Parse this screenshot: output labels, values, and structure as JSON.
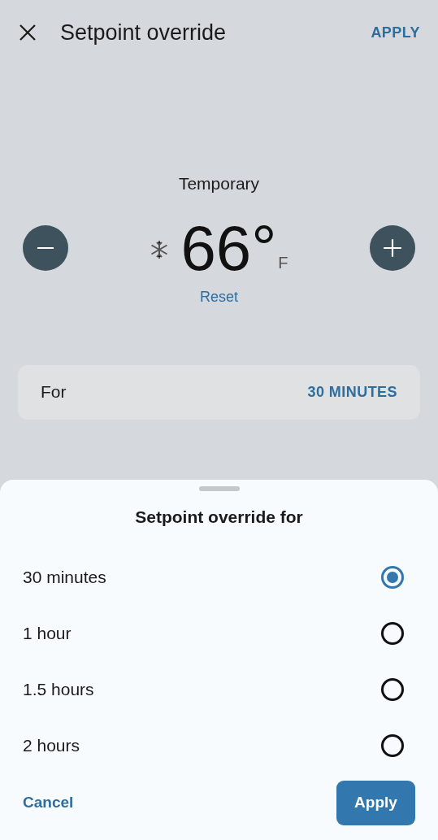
{
  "header": {
    "title": "Setpoint override",
    "action": "APPLY"
  },
  "setpoint": {
    "mode": "Temporary",
    "value": "66°",
    "unit": "F",
    "reset": "Reset"
  },
  "duration": {
    "label": "For",
    "value": "30 MINUTES"
  },
  "sheet": {
    "title": "Setpoint override for",
    "options": [
      {
        "label": "30 minutes",
        "selected": true
      },
      {
        "label": "1 hour",
        "selected": false
      },
      {
        "label": "1.5 hours",
        "selected": false
      },
      {
        "label": "2 hours",
        "selected": false
      }
    ],
    "cancel": "Cancel",
    "apply": "Apply"
  }
}
